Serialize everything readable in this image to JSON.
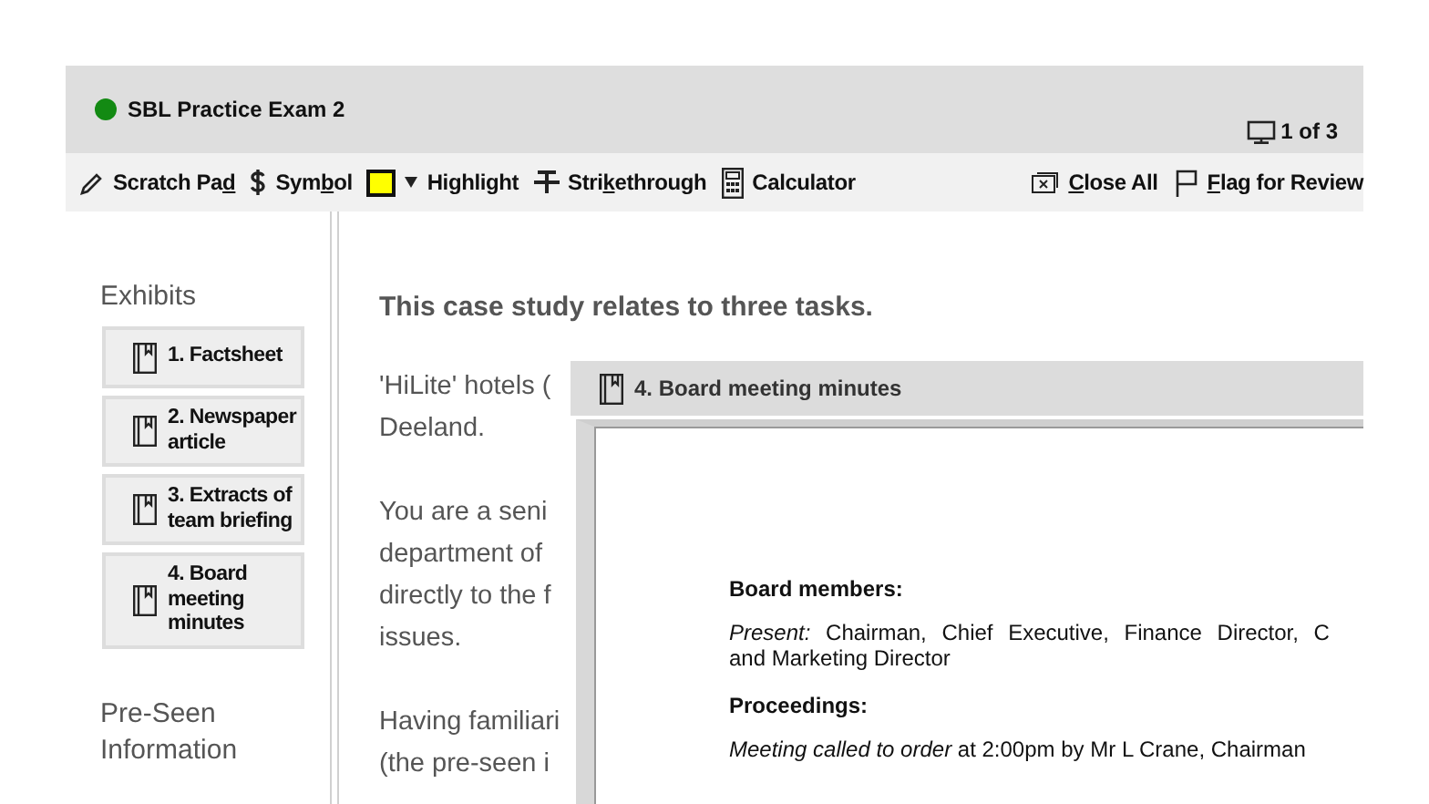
{
  "header": {
    "status": {
      "color": "#138a13"
    },
    "title": "SBL Practice Exam 2",
    "page_indicator": "1 of 3"
  },
  "toolbar": {
    "left": [
      {
        "kind": "pencil",
        "before": "Scratch Pa",
        "access_key": "d"
      },
      {
        "kind": "dollar",
        "before": "Sym",
        "access_key": "b",
        "after": "ol"
      },
      {
        "kind": "highlight",
        "before": "Highlight",
        "color": "#ffff00"
      },
      {
        "kind": "strike",
        "before": "Stri",
        "access_key": "k",
        "after": "ethrough"
      },
      {
        "kind": "calculator",
        "before": "Calculator"
      }
    ],
    "right": [
      {
        "kind": "closeall",
        "access_key": "C",
        "after": "lose All"
      },
      {
        "kind": "flag",
        "access_key": "F",
        "after": "lag for Review"
      }
    ]
  },
  "sidebar": {
    "heading": "Exhibits",
    "exhibits": [
      "1. Factsheet",
      "2. Newspaper article",
      "3. Extracts of team briefing",
      "4. Board meeting minutes"
    ],
    "section": [
      "Pre-Seen",
      "Information"
    ]
  },
  "main": {
    "heading": "This case study relates to three tasks.",
    "paragraphs": [
      [
        "'HiLite' hotels (",
        "Deeland."
      ],
      [
        "You are a seni",
        "department of",
        "directly to the f",
        "issues."
      ],
      [
        "Having familiari",
        "(the pre-seen i"
      ]
    ]
  },
  "exhibit_window": {
    "title": "4. Board meeting minutes",
    "blocks": [
      {
        "kind": "heading",
        "text": "Board members:"
      },
      {
        "kind": "para",
        "lines": [
          "*Present:* Chairman, Chief Executive, Finance Director, C",
          "and Marketing Director"
        ]
      },
      {
        "kind": "heading",
        "text": "Proceedings:"
      },
      {
        "kind": "para",
        "lines": [
          "*Meeting called to order* at 2:00pm by Mr L Crane, Chairman"
        ]
      }
    ]
  }
}
